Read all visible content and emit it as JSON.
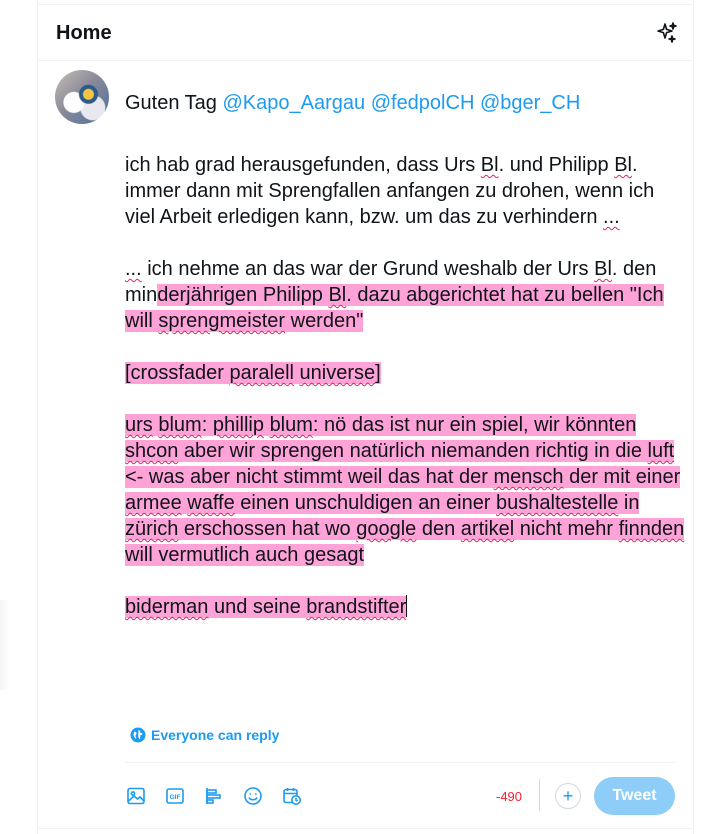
{
  "header": {
    "title": "Home",
    "sparkle_icon": "sparkle-icon"
  },
  "composer": {
    "greeting": "Guten Tag",
    "mentions": [
      "@Kapo_Aargau",
      "@fedpolCH",
      "@bger_CH"
    ],
    "p1": {
      "t1": "ich hab grad herausgefunden, dass Urs ",
      "w1": "Bl",
      "t2": ". und Philipp",
      "w2": "Bl",
      "t3": ". immer dann mit Sprengfallen anfangen zu drohen, wenn ich viel Arbeit erledigen kann, bzw. um das zu verhindern ",
      "w3": "..."
    },
    "p2": {
      "w1": "...",
      "t1": " ich nehme an das war der Grund weshalb der Urs ",
      "w2": "Bl",
      "t2": ". den min",
      "h1": "derjährigen Philipp ",
      "h2": "Bl",
      "h3": ". dazu abgerichtet hat zu bellen \"Ich will ",
      "h4": "sprengmeister",
      "h5": " werden\""
    },
    "p3": {
      "t1": "[crossfader ",
      "w1": "paralell",
      "t2": " ",
      "w2": "universe",
      "t3": "]"
    },
    "p4": {
      "w1": "urs",
      "t1": " ",
      "w2": "blum",
      "t2": ": ",
      "w3": "phillip",
      "t3": " ",
      "w4": "blum",
      "t4": ": nö das ist nur ein spiel, wir könnten ",
      "w5": "shcon",
      "t5": " aber wir sprengen natürlich niemanden richtig in die ",
      "w6": "luft",
      "t6": " <- was aber nicht stimmt weil das hat der ",
      "w7": "mensch",
      "t7": " der mit einer ",
      "w8": "armee",
      "t8": " ",
      "w9": "waffe",
      "t9": " einen unschuldigen an einer ",
      "w10": "bushaltestelle",
      "t10": " in ",
      "w11": "zürich",
      "t11": " erschossen hat wo ",
      "w12": "google",
      "t12": " den ",
      "w13": "artikel",
      "t13": " nicht mehr ",
      "w14": "finnden",
      "t14": " will vermutlich auch gesagt"
    },
    "p5": {
      "w1": "biderman",
      "t1": " und seine ",
      "w2": "brandstifter"
    }
  },
  "reply_setting": {
    "label": "Everyone can reply",
    "icon": "globe-icon"
  },
  "toolbar": {
    "icons": [
      "image-icon",
      "gif-icon",
      "poll-icon",
      "emoji-icon",
      "schedule-icon"
    ],
    "gif_text": "GIF"
  },
  "counter": {
    "value": "-490"
  },
  "plus_label": "+",
  "tweet_button": {
    "label": "Tweet"
  },
  "colors": {
    "accent": "#1d9bf0",
    "highlight": "#ffa2d8",
    "error": "#f4212e",
    "button_disabled": "#8ecdf8"
  }
}
